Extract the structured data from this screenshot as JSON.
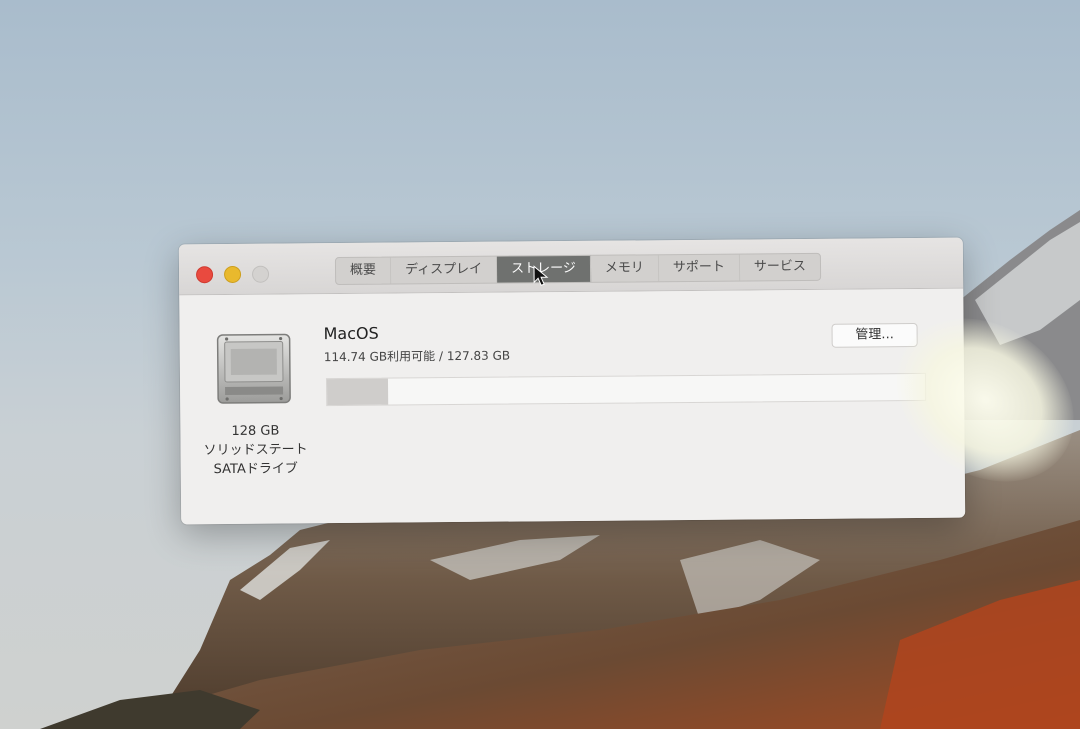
{
  "window": {
    "tabs": [
      {
        "label": "概要",
        "active": false
      },
      {
        "label": "ディスプレイ",
        "active": false
      },
      {
        "label": "ストレージ",
        "active": true
      },
      {
        "label": "メモリ",
        "active": false
      },
      {
        "label": "サポート",
        "active": false
      },
      {
        "label": "サービス",
        "active": false
      }
    ]
  },
  "drive": {
    "icon": "ssd-drive-icon",
    "size": "128 GB",
    "type_line1": "ソリッドステート",
    "type_line2": "SATAドライブ"
  },
  "volume": {
    "name": "MacOS",
    "capacity": "114.74 GB利用可能 / 127.83 GB",
    "used_fraction": 0.102
  },
  "manage_button": {
    "label": "管理..."
  },
  "colors": {
    "close": "#e94a3f",
    "minimize": "#e9b92d",
    "active_tab": "#6f716f"
  }
}
